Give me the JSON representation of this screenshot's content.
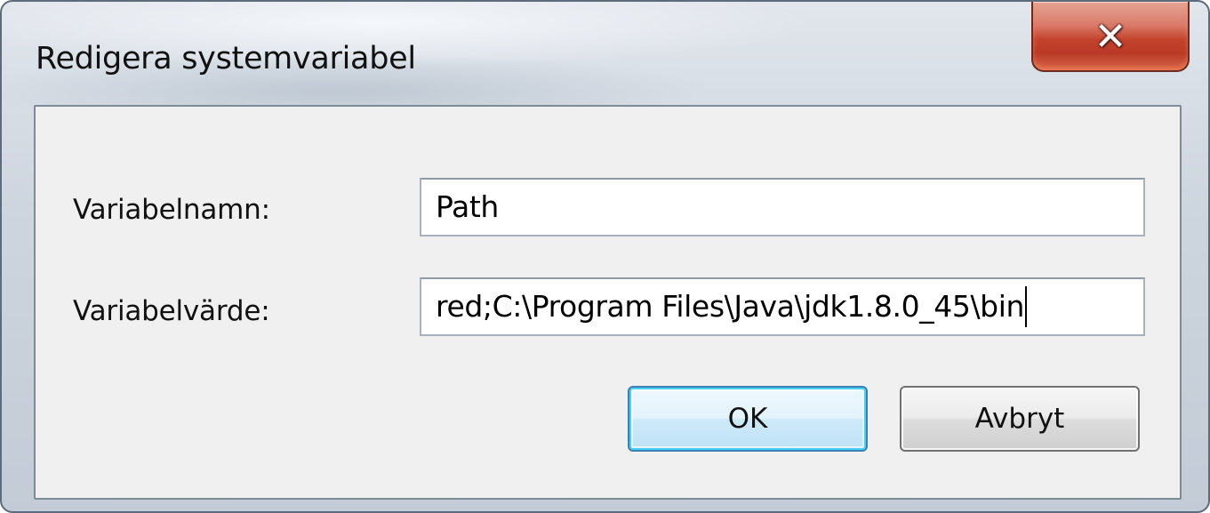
{
  "window": {
    "title": "Redigera systemvariabel",
    "close_glyph": "✕",
    "close_icon": "close-icon"
  },
  "form": {
    "name_label": "Variabelnamn:",
    "name_value": "Path",
    "value_label": "Variabelvärde:",
    "value_value": "red;C:\\Program Files\\Java\\jdk1.8.0_45\\bin"
  },
  "buttons": {
    "ok_label": "OK",
    "cancel_label": "Avbryt"
  },
  "colors": {
    "close_button": "#c3432d",
    "default_button_border": "#3c7fb1",
    "client_background": "#f0f0f0"
  }
}
